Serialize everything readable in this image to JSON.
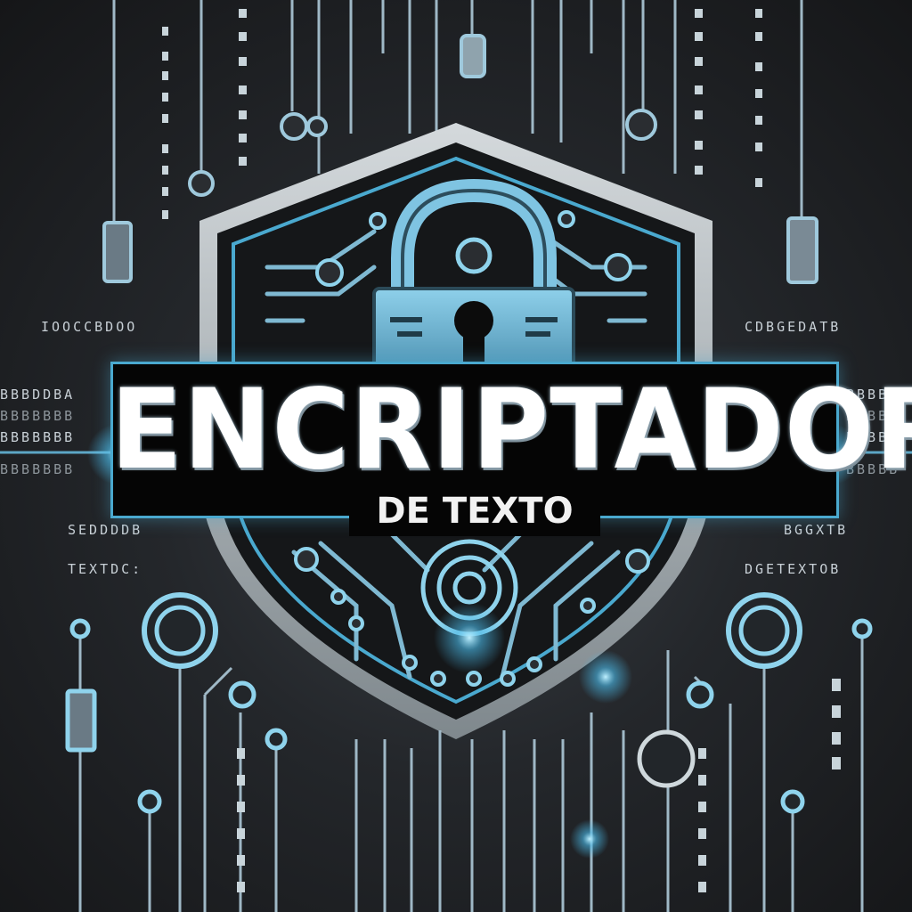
{
  "title": "ENCRIPTADOR",
  "subtitle": "DE TEXTO",
  "decor_text": {
    "left_row_1": "IOOCCBDOO",
    "left_row_2": "BBBDDBA",
    "left_row_3": "BBBBBBB",
    "left_row_4": "BBBBBBB",
    "left_row_5": "BBBBBBB",
    "left_code": "SEDDDDB",
    "left_textdc": "TEXTDC:",
    "right_row_1": "CDBGEDATB",
    "right_row_2": "BBBBB",
    "right_row_3": "BBBBB",
    "right_row_4": "BBBBB",
    "right_row_5": "BBBBB",
    "right_xtb": "BGGXTB",
    "right_textdb": "DGETEXTOB"
  },
  "icons": {
    "lock": "padlock-icon",
    "shield": "shield-icon",
    "circuit": "circuit-icon"
  },
  "colors": {
    "accent": "#4aa9cf",
    "accent_light": "#8fd3ec",
    "background": "#1e2023",
    "shield_rim": "#b9c0c5",
    "banner": "#050505",
    "title": "#ffffff"
  }
}
